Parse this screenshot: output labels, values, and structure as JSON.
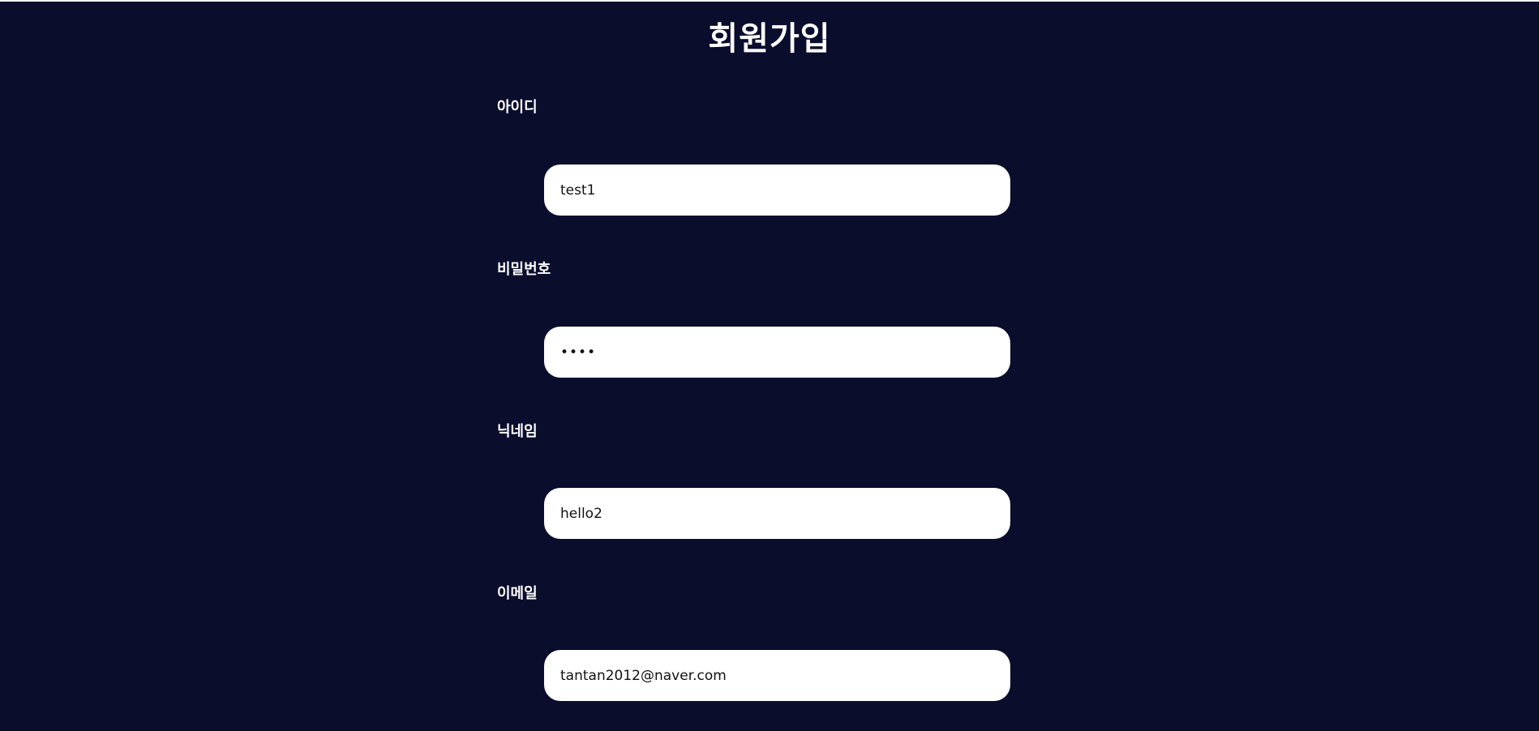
{
  "header": {
    "title": "회원가입"
  },
  "form": {
    "fields": [
      {
        "label": "아이디",
        "value": "test1",
        "type": "text"
      },
      {
        "label": "비밀번호",
        "value": "1234",
        "type": "password"
      },
      {
        "label": "닉네임",
        "value": "hello2",
        "type": "text"
      },
      {
        "label": "이메일",
        "value": "tantan2012@naver.com",
        "type": "email"
      }
    ]
  },
  "colors": {
    "background": "#0b0d2d",
    "input_background": "#ffffff",
    "label_text": "#ffffff"
  }
}
